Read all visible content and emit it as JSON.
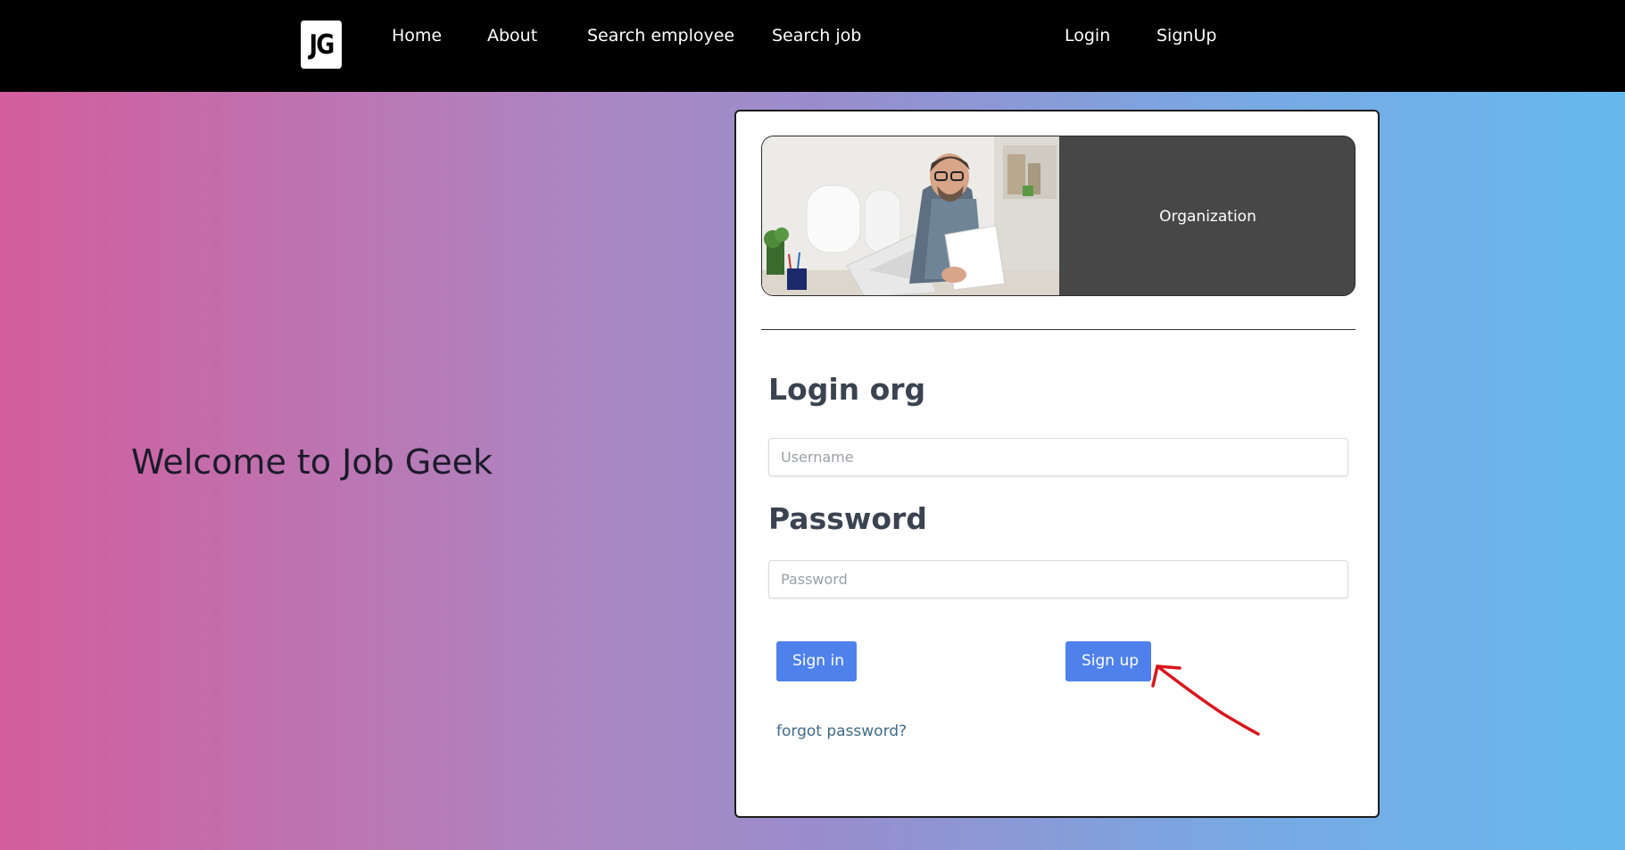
{
  "navbar": {
    "logo_text": "JG",
    "links": [
      {
        "label": "Home"
      },
      {
        "label": "About"
      },
      {
        "label": "Search employee"
      },
      {
        "label": "Search job"
      }
    ],
    "auth_links": [
      {
        "label": "Login"
      },
      {
        "label": "SignUp"
      }
    ]
  },
  "hero": {
    "welcome": "Welcome to Job Geek"
  },
  "card": {
    "banner_label": "Organization",
    "login_heading": "Login org",
    "username_placeholder": "Username",
    "password_heading": "Password",
    "password_placeholder": "Password",
    "signin_label": "Sign in",
    "signup_label": "Sign up",
    "forgot_label": "forgot password?"
  },
  "colors": {
    "navbar_bg": "#000000",
    "button_bg": "#4f81ec",
    "annotation": "#d8161c",
    "gradient_start": "#d35d9d",
    "gradient_end": "#66b9ef"
  }
}
